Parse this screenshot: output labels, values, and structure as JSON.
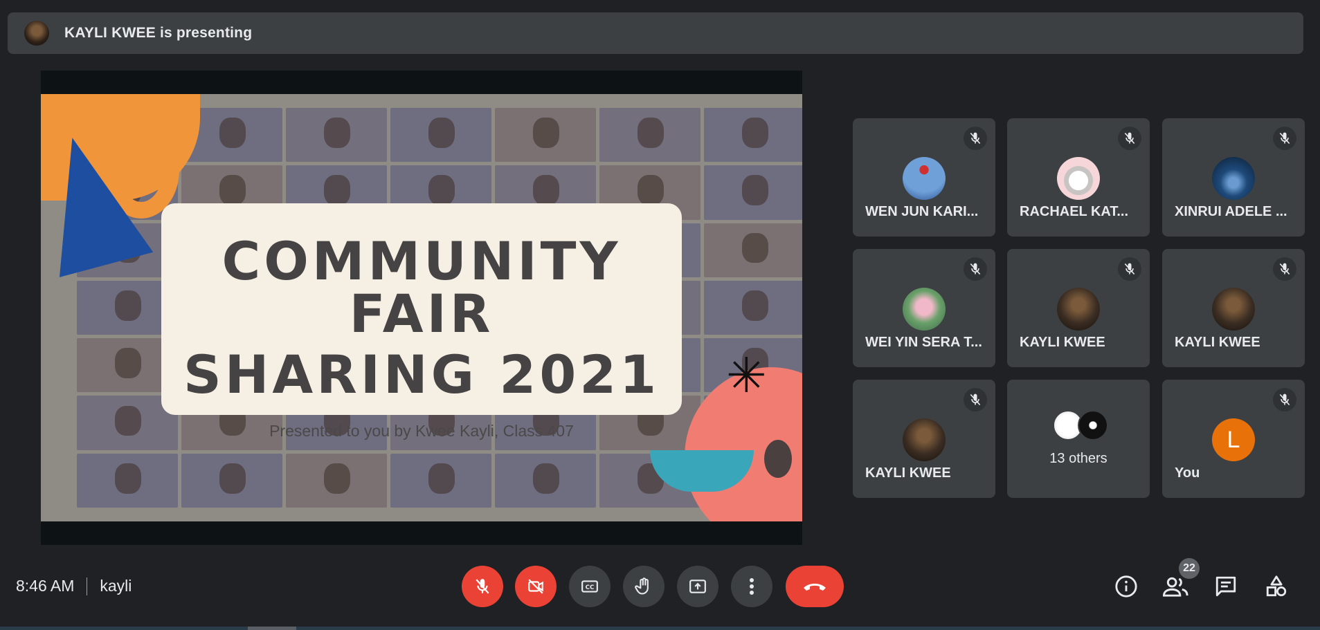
{
  "banner": {
    "text": "KAYLI KWEE is presenting"
  },
  "slide": {
    "title_line1": "COMMUNITY FAIR",
    "title_line2": "SHARING 2021",
    "subtitle": "Presented to you by Kwee Kayli, Class 407"
  },
  "participants": [
    {
      "name": "WEN JUN KARI...",
      "muted": true,
      "avatar_color": "#4a7fbf"
    },
    {
      "name": "RACHAEL KAT...",
      "muted": true,
      "avatar_color": "#f3d3d3"
    },
    {
      "name": "XINRUI ADELE ...",
      "muted": true,
      "avatar_color": "#1b3b60"
    },
    {
      "name": "WEI YIN SERA T...",
      "muted": true,
      "avatar_color": "#6a9a6a"
    },
    {
      "name": "KAYLI KWEE",
      "muted": true,
      "avatar_color": "#3a2c22"
    },
    {
      "name": "KAYLI KWEE",
      "muted": true,
      "avatar_color": "#3a2c22"
    },
    {
      "name": "KAYLI KWEE",
      "muted": true,
      "avatar_color": "#3a2c22"
    }
  ],
  "others": {
    "label": "13 others"
  },
  "self": {
    "name": "You",
    "initial": "L",
    "muted": true,
    "avatar_color": "#e8710a"
  },
  "footer": {
    "time": "8:46 AM",
    "meeting_name": "kayli",
    "people_count": "22"
  },
  "icons": {
    "mic": "mic-off-icon",
    "camera": "camera-off-icon",
    "captions": "captions-icon",
    "hand": "raise-hand-icon",
    "present": "present-screen-icon",
    "more": "more-options-icon",
    "hangup": "hang-up-icon",
    "info": "info-icon",
    "people": "people-icon",
    "chat": "chat-icon",
    "activities": "activities-icon"
  },
  "colors": {
    "red": "#ea4335",
    "tile": "#3c4043",
    "background": "#202124"
  }
}
